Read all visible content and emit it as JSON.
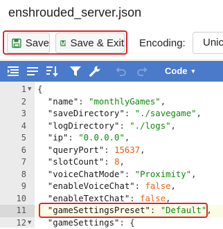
{
  "window": {
    "title": "enshrouded_server.json"
  },
  "toolbar": {
    "save_label": "Save",
    "save_exit_label": "Save & Exit",
    "encoding_label": "Encoding:",
    "encoding_value": "Unic"
  },
  "menubar": {
    "icons": [
      "format-icon",
      "compact-icon",
      "sort-icon",
      "filter-icon",
      "repair-icon",
      "undo-icon",
      "redo-icon"
    ],
    "mode_label": "Code",
    "bar_color": "#4a7ac9"
  },
  "code": {
    "lines": [
      {
        "n": "1",
        "fold": "▼",
        "text": "{",
        "parts": [
          {
            "t": "{",
            "c": "p"
          }
        ]
      },
      {
        "n": "2",
        "parts": [
          {
            "t": "  \"name\"",
            "c": "k"
          },
          {
            "t": ": ",
            "c": "p"
          },
          {
            "t": "\"monthlyGames\"",
            "c": "s"
          },
          {
            "t": ",",
            "c": "p"
          }
        ]
      },
      {
        "n": "3",
        "parts": [
          {
            "t": "  \"saveDirectory\"",
            "c": "k"
          },
          {
            "t": ": ",
            "c": "p"
          },
          {
            "t": "\"./savegame\"",
            "c": "s"
          },
          {
            "t": ",",
            "c": "p"
          }
        ]
      },
      {
        "n": "4",
        "parts": [
          {
            "t": "  \"logDirectory\"",
            "c": "k"
          },
          {
            "t": ": ",
            "c": "p"
          },
          {
            "t": "\"./logs\"",
            "c": "s"
          },
          {
            "t": ",",
            "c": "p"
          }
        ]
      },
      {
        "n": "5",
        "parts": [
          {
            "t": "  \"ip\"",
            "c": "k"
          },
          {
            "t": ": ",
            "c": "p"
          },
          {
            "t": "\"0.0.0.0\"",
            "c": "s"
          },
          {
            "t": ",",
            "c": "p"
          }
        ]
      },
      {
        "n": "6",
        "parts": [
          {
            "t": "  \"queryPort\"",
            "c": "k"
          },
          {
            "t": ": ",
            "c": "p"
          },
          {
            "t": "15637",
            "c": "n"
          },
          {
            "t": ",",
            "c": "p"
          }
        ]
      },
      {
        "n": "7",
        "parts": [
          {
            "t": "  \"slotCount\"",
            "c": "k"
          },
          {
            "t": ": ",
            "c": "p"
          },
          {
            "t": "8",
            "c": "n"
          },
          {
            "t": ",",
            "c": "p"
          }
        ]
      },
      {
        "n": "8",
        "parts": [
          {
            "t": "  \"voiceChatMode\"",
            "c": "k"
          },
          {
            "t": ": ",
            "c": "p"
          },
          {
            "t": "\"Proximity\"",
            "c": "s"
          },
          {
            "t": ",",
            "c": "p"
          }
        ]
      },
      {
        "n": "9",
        "parts": [
          {
            "t": "  \"enableVoiceChat\"",
            "c": "k"
          },
          {
            "t": ": ",
            "c": "p"
          },
          {
            "t": "false",
            "c": "b"
          },
          {
            "t": ",",
            "c": "p"
          }
        ]
      },
      {
        "n": "10",
        "parts": [
          {
            "t": "  \"enableTextChat\"",
            "c": "k"
          },
          {
            "t": ": ",
            "c": "p"
          },
          {
            "t": "false",
            "c": "b"
          },
          {
            "t": ",",
            "c": "p"
          }
        ]
      },
      {
        "n": "11",
        "active": true,
        "parts": [
          {
            "t": "  \"gameSettingsPreset\"",
            "c": "k"
          },
          {
            "t": ": ",
            "c": "p"
          },
          {
            "t": "\"Default\"",
            "c": "s"
          },
          {
            "t": ",",
            "c": "p"
          }
        ]
      },
      {
        "n": "12",
        "fold": "▼",
        "parts": [
          {
            "t": "  \"gameSettings\"",
            "c": "k"
          },
          {
            "t": ": {",
            "c": "p"
          }
        ]
      }
    ]
  },
  "colors": {
    "highlight": "#e32424",
    "string": "#0a8a0a",
    "number": "#e05d10"
  }
}
